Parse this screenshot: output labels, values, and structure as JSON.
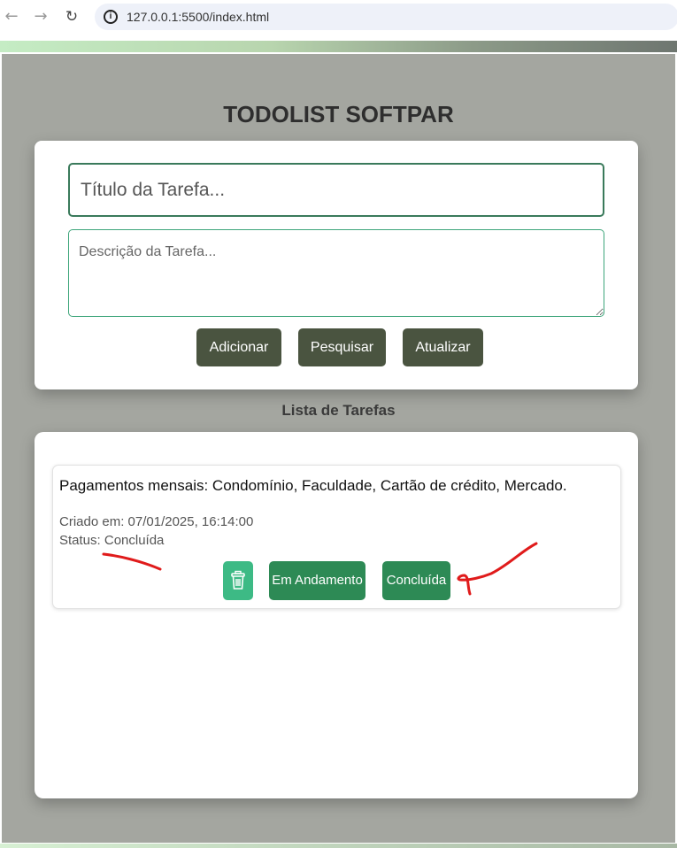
{
  "browser": {
    "url": "127.0.0.1:5500/index.html"
  },
  "app": {
    "title": "TODOLIST SOFTPAR"
  },
  "form": {
    "title_placeholder": "Título da Tarefa...",
    "description_placeholder": "Descrição da Tarefa...",
    "add_label": "Adicionar",
    "search_label": "Pesquisar",
    "update_label": "Atualizar"
  },
  "list": {
    "heading": "Lista de Tarefas",
    "tasks": [
      {
        "title": "Pagamentos mensais: Condomínio, Faculdade, Cartão de crédito, Mercado.",
        "created": "Criado em: 07/01/2025, 16:14:00",
        "status": "Status: Concluída",
        "in_progress_label": "Em Andamento",
        "done_label": "Concluída"
      }
    ]
  },
  "colors": {
    "page_background": "#a4a6a0",
    "dark_button": "#4a5440",
    "green_button": "#2d8a55",
    "trash_button": "#3dba85",
    "annotation": "#e01b1b"
  },
  "icons": {
    "back": "arrow-left-icon",
    "forward": "arrow-right-icon",
    "reload": "reload-icon",
    "info": "info-icon",
    "trash": "trash-icon"
  }
}
